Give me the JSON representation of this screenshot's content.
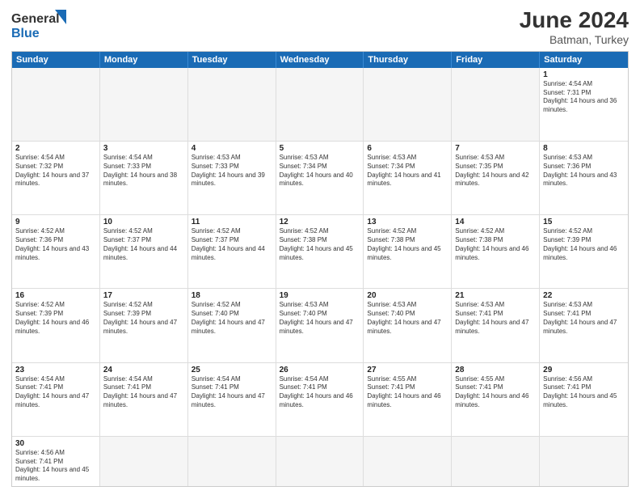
{
  "header": {
    "logo_general": "General",
    "logo_blue": "Blue",
    "title": "June 2024",
    "subtitle": "Batman, Turkey"
  },
  "days_of_week": [
    "Sunday",
    "Monday",
    "Tuesday",
    "Wednesday",
    "Thursday",
    "Friday",
    "Saturday"
  ],
  "weeks": [
    [
      {
        "day": "",
        "info": ""
      },
      {
        "day": "",
        "info": ""
      },
      {
        "day": "",
        "info": ""
      },
      {
        "day": "",
        "info": ""
      },
      {
        "day": "",
        "info": ""
      },
      {
        "day": "",
        "info": ""
      },
      {
        "day": "1",
        "info": "Sunrise: 4:54 AM\nSunset: 7:31 PM\nDaylight: 14 hours and 36 minutes."
      }
    ],
    [
      {
        "day": "2",
        "info": "Sunrise: 4:54 AM\nSunset: 7:32 PM\nDaylight: 14 hours and 37 minutes."
      },
      {
        "day": "3",
        "info": "Sunrise: 4:54 AM\nSunset: 7:33 PM\nDaylight: 14 hours and 38 minutes."
      },
      {
        "day": "4",
        "info": "Sunrise: 4:53 AM\nSunset: 7:33 PM\nDaylight: 14 hours and 39 minutes."
      },
      {
        "day": "5",
        "info": "Sunrise: 4:53 AM\nSunset: 7:34 PM\nDaylight: 14 hours and 40 minutes."
      },
      {
        "day": "6",
        "info": "Sunrise: 4:53 AM\nSunset: 7:34 PM\nDaylight: 14 hours and 41 minutes."
      },
      {
        "day": "7",
        "info": "Sunrise: 4:53 AM\nSunset: 7:35 PM\nDaylight: 14 hours and 42 minutes."
      },
      {
        "day": "8",
        "info": "Sunrise: 4:53 AM\nSunset: 7:36 PM\nDaylight: 14 hours and 43 minutes."
      }
    ],
    [
      {
        "day": "9",
        "info": "Sunrise: 4:52 AM\nSunset: 7:36 PM\nDaylight: 14 hours and 43 minutes."
      },
      {
        "day": "10",
        "info": "Sunrise: 4:52 AM\nSunset: 7:37 PM\nDaylight: 14 hours and 44 minutes."
      },
      {
        "day": "11",
        "info": "Sunrise: 4:52 AM\nSunset: 7:37 PM\nDaylight: 14 hours and 44 minutes."
      },
      {
        "day": "12",
        "info": "Sunrise: 4:52 AM\nSunset: 7:38 PM\nDaylight: 14 hours and 45 minutes."
      },
      {
        "day": "13",
        "info": "Sunrise: 4:52 AM\nSunset: 7:38 PM\nDaylight: 14 hours and 45 minutes."
      },
      {
        "day": "14",
        "info": "Sunrise: 4:52 AM\nSunset: 7:38 PM\nDaylight: 14 hours and 46 minutes."
      },
      {
        "day": "15",
        "info": "Sunrise: 4:52 AM\nSunset: 7:39 PM\nDaylight: 14 hours and 46 minutes."
      }
    ],
    [
      {
        "day": "16",
        "info": "Sunrise: 4:52 AM\nSunset: 7:39 PM\nDaylight: 14 hours and 46 minutes."
      },
      {
        "day": "17",
        "info": "Sunrise: 4:52 AM\nSunset: 7:39 PM\nDaylight: 14 hours and 47 minutes."
      },
      {
        "day": "18",
        "info": "Sunrise: 4:52 AM\nSunset: 7:40 PM\nDaylight: 14 hours and 47 minutes."
      },
      {
        "day": "19",
        "info": "Sunrise: 4:53 AM\nSunset: 7:40 PM\nDaylight: 14 hours and 47 minutes."
      },
      {
        "day": "20",
        "info": "Sunrise: 4:53 AM\nSunset: 7:40 PM\nDaylight: 14 hours and 47 minutes."
      },
      {
        "day": "21",
        "info": "Sunrise: 4:53 AM\nSunset: 7:41 PM\nDaylight: 14 hours and 47 minutes."
      },
      {
        "day": "22",
        "info": "Sunrise: 4:53 AM\nSunset: 7:41 PM\nDaylight: 14 hours and 47 minutes."
      }
    ],
    [
      {
        "day": "23",
        "info": "Sunrise: 4:54 AM\nSunset: 7:41 PM\nDaylight: 14 hours and 47 minutes."
      },
      {
        "day": "24",
        "info": "Sunrise: 4:54 AM\nSunset: 7:41 PM\nDaylight: 14 hours and 47 minutes."
      },
      {
        "day": "25",
        "info": "Sunrise: 4:54 AM\nSunset: 7:41 PM\nDaylight: 14 hours and 47 minutes."
      },
      {
        "day": "26",
        "info": "Sunrise: 4:54 AM\nSunset: 7:41 PM\nDaylight: 14 hours and 46 minutes."
      },
      {
        "day": "27",
        "info": "Sunrise: 4:55 AM\nSunset: 7:41 PM\nDaylight: 14 hours and 46 minutes."
      },
      {
        "day": "28",
        "info": "Sunrise: 4:55 AM\nSunset: 7:41 PM\nDaylight: 14 hours and 46 minutes."
      },
      {
        "day": "29",
        "info": "Sunrise: 4:56 AM\nSunset: 7:41 PM\nDaylight: 14 hours and 45 minutes."
      }
    ],
    [
      {
        "day": "30",
        "info": "Sunrise: 4:56 AM\nSunset: 7:41 PM\nDaylight: 14 hours and 45 minutes."
      },
      {
        "day": "",
        "info": ""
      },
      {
        "day": "",
        "info": ""
      },
      {
        "day": "",
        "info": ""
      },
      {
        "day": "",
        "info": ""
      },
      {
        "day": "",
        "info": ""
      },
      {
        "day": "",
        "info": ""
      }
    ]
  ]
}
